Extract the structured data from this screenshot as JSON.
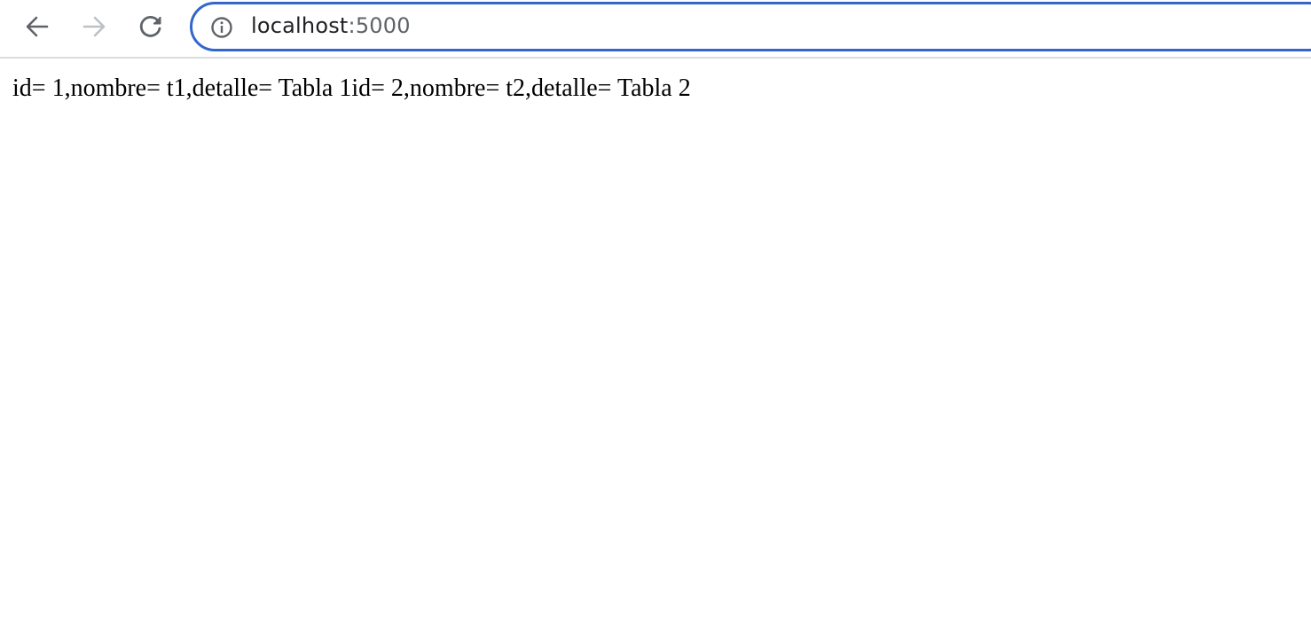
{
  "browser": {
    "url_host": "localhost",
    "url_port": ":5000",
    "accent_color": "#3366cc",
    "icons": {
      "back": "arrow-left-icon",
      "forward": "arrow-right-icon",
      "reload": "reload-icon",
      "site_info": "info-icon"
    }
  },
  "page": {
    "body_text": "id= 1,nombre= t1,detalle= Tabla 1id= 2,nombre= t2,detalle= Tabla 2"
  }
}
